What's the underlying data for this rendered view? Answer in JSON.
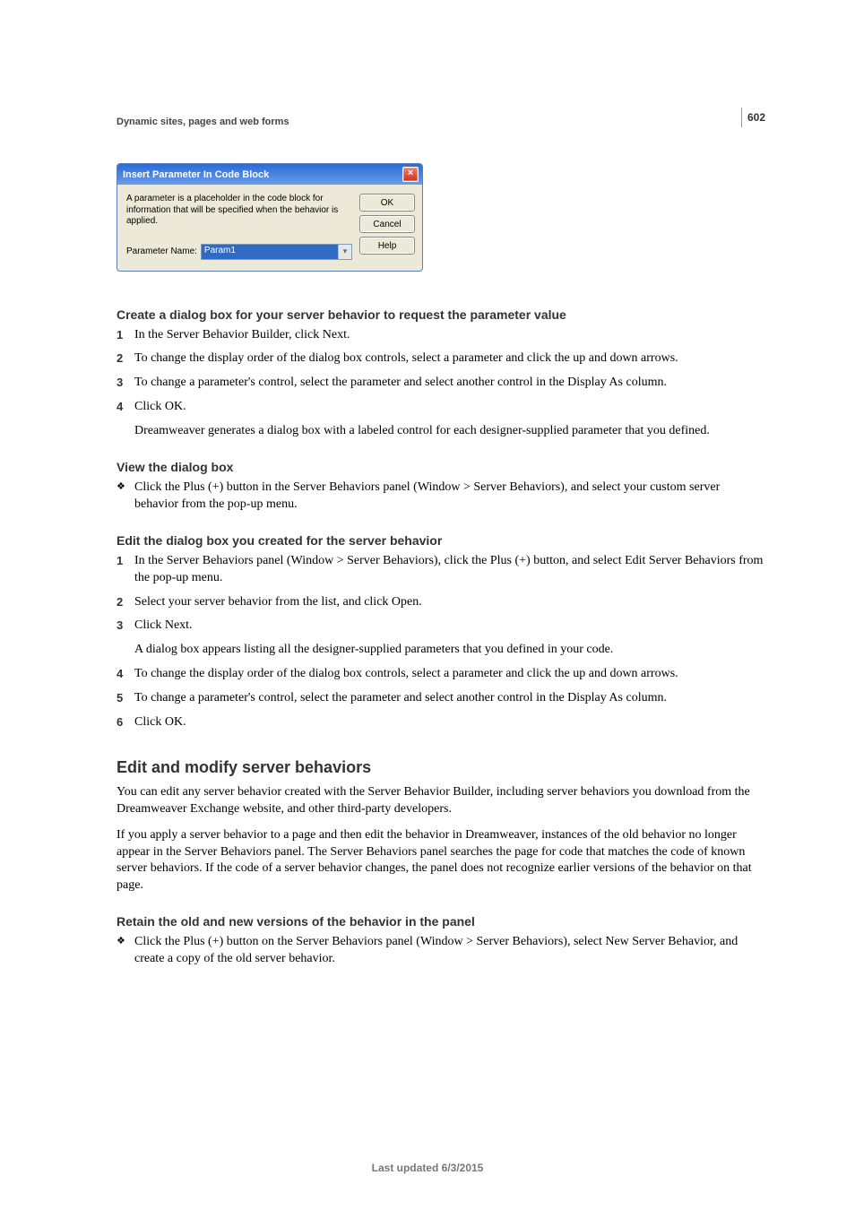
{
  "page_number": "602",
  "breadcrumb": "Dynamic sites, pages and web forms",
  "dialog": {
    "title": "Insert Parameter In Code Block",
    "description": "A parameter is a placeholder in the code block for information that will be specified when the behavior is applied.",
    "param_label": "Parameter Name:",
    "param_value": "Param1",
    "ok": "OK",
    "cancel": "Cancel",
    "help": "Help",
    "close_glyph": "×"
  },
  "h3_create": "Create a dialog box for your server behavior to request the parameter value",
  "create_steps": [
    "In the Server Behavior Builder, click Next.",
    "To change the display order of the dialog box controls, select a parameter and click the up and down arrows.",
    "To change a parameter's control, select the parameter and select another control in the Display As column.",
    "Click OK."
  ],
  "create_after": "Dreamweaver generates a dialog box with a labeled control for each designer-supplied parameter that you defined.",
  "h3_view": "View the dialog box",
  "view_bullet": "Click the Plus (+) button in the Server Behaviors panel (Window > Server Behaviors), and select your custom server behavior from the pop-up menu.",
  "h3_edit_dialog": "Edit the dialog box you created for the server behavior",
  "edit_steps": {
    "s1": "In the Server Behaviors panel (Window > Server Behaviors), click the Plus (+) button, and select Edit Server Behaviors from the pop-up menu.",
    "s2": "Select your server behavior from the list, and click Open.",
    "s3": "Click Next.",
    "s3_sub": "A dialog box appears listing all the designer-supplied parameters that you defined in your code.",
    "s4": "To change the display order of the dialog box controls, select a parameter and click the up and down arrows.",
    "s5": "To change a parameter's control, select the parameter and select another control in the Display As column.",
    "s6": "Click OK."
  },
  "h2_edit_modify": "Edit and modify server behaviors",
  "edit_modify_p1": "You can edit any server behavior created with the Server Behavior Builder, including server behaviors you download from the Dreamweaver Exchange website, and other third-party developers.",
  "edit_modify_p2": "If you apply a server behavior to a page and then edit the behavior in Dreamweaver, instances of the old behavior no longer appear in the Server Behaviors panel. The Server Behaviors panel searches the page for code that matches the code of known server behaviors. If the code of a server behavior changes, the panel does not recognize earlier versions of the behavior on that page.",
  "h3_retain": "Retain the old and new versions of the behavior in the panel",
  "retain_bullet": "Click the Plus (+) button on the Server Behaviors panel (Window > Server Behaviors), select New Server Behavior, and create a copy of the old server behavior.",
  "footer": "Last updated 6/3/2015"
}
